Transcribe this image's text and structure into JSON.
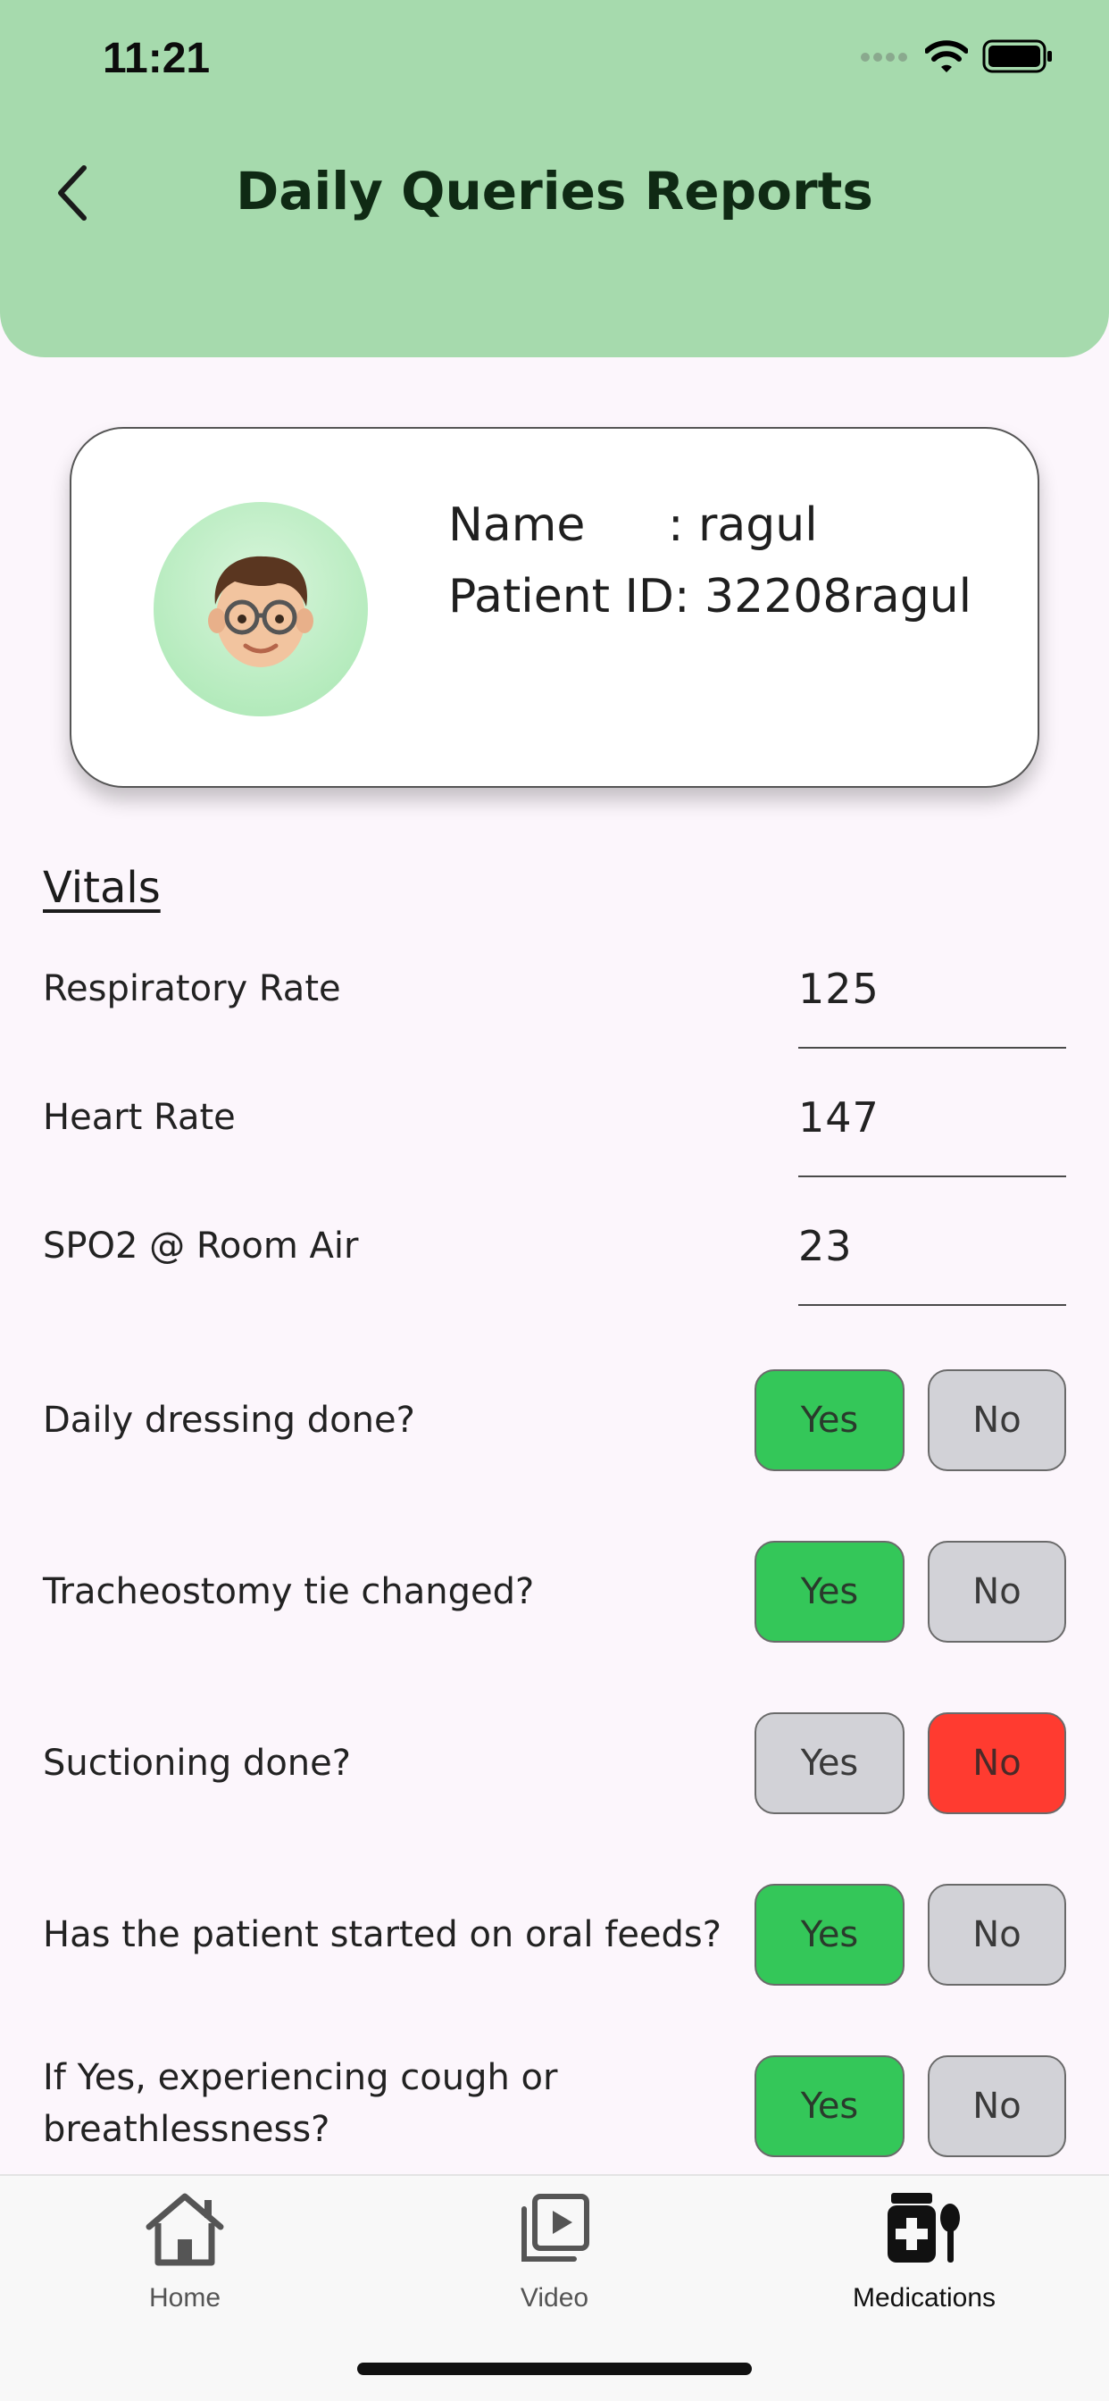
{
  "status_bar": {
    "time": "11:21"
  },
  "header": {
    "title": "Daily Queries Reports"
  },
  "profile": {
    "name_label": "Name",
    "name_value": ": ragul",
    "patient_id_label": "Patient ID:",
    "patient_id_value": "32208ragul"
  },
  "vitals": {
    "title": "Vitals",
    "items": [
      {
        "label": "Respiratory Rate",
        "value": "125"
      },
      {
        "label": "Heart Rate",
        "value": "147"
      },
      {
        "label": "SPO2 @ Room Air",
        "value": "23"
      }
    ]
  },
  "questions": [
    {
      "label": "Daily dressing done?",
      "yes": "Yes",
      "no": "No",
      "answer": "Yes"
    },
    {
      "label": "Tracheostomy tie changed?",
      "yes": "Yes",
      "no": "No",
      "answer": "Yes"
    },
    {
      "label": "Suctioning done?",
      "yes": "Yes",
      "no": "No",
      "answer": "No"
    },
    {
      "label": "Has the patient started on oral feeds?",
      "yes": "Yes",
      "no": "No",
      "answer": "Yes"
    },
    {
      "label_line1": "If Yes, experiencing cough or",
      "label_line2": "breathlessness?",
      "yes": "Yes",
      "no": "No",
      "answer": "Yes"
    }
  ],
  "tabs": [
    {
      "label": "Home",
      "icon": "home-icon"
    },
    {
      "label": "Video",
      "icon": "video-icon"
    },
    {
      "label": "Medications",
      "icon": "medications-icon",
      "active": true
    }
  ],
  "colors": {
    "header": "#a6daad",
    "yes_selected": "#34c759",
    "no_selected": "#ff3b30",
    "unselected": "#d2d2d7"
  }
}
